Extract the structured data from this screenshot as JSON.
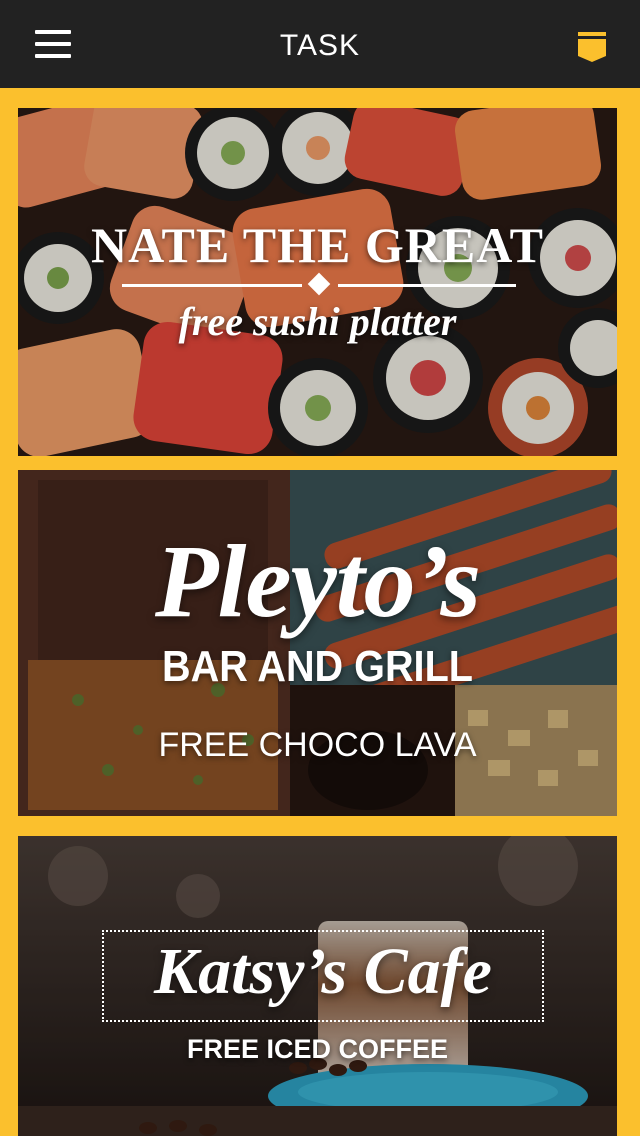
{
  "header": {
    "title": "TASK",
    "menu_icon": "hamburger-menu-icon",
    "bookmark_icon": "bookmark-icon",
    "bar_color": "#222222",
    "accent_color": "#fbc02d"
  },
  "offers": [
    {
      "title": "NATE THE GREAT",
      "subtitle": "free sushi platter"
    },
    {
      "title_script": "Pleyto’s",
      "title_sub": "BAR AND GRILL",
      "subtitle": "FREE CHOCO LAVA"
    },
    {
      "title": "Katsy’s Cafe",
      "subtitle": "FREE ICED COFFEE"
    }
  ]
}
